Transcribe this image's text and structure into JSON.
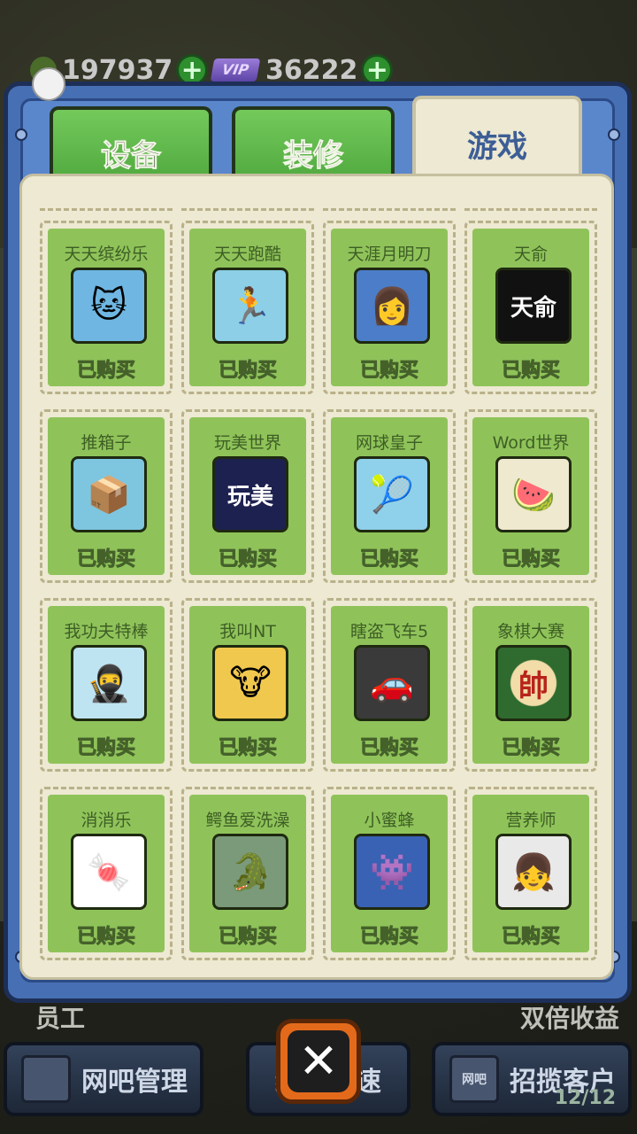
{
  "currencies": {
    "coins": "197937",
    "vip_label": "VIP",
    "vip_points": "36222"
  },
  "tabs": [
    {
      "label": "设备",
      "active": false
    },
    {
      "label": "装修",
      "active": false
    },
    {
      "label": "游戏",
      "active": true
    }
  ],
  "games": [
    {
      "name": "天天缤纷乐",
      "status": "已购买",
      "icon": "cat-icon",
      "bg": "#6fb7e2",
      "glyph": "🐱"
    },
    {
      "name": "天天跑酷",
      "status": "已购买",
      "icon": "runner-icon",
      "bg": "#8ccfe6",
      "glyph": "🏃"
    },
    {
      "name": "天涯月明刀",
      "status": "已购买",
      "icon": "swordswoman-icon",
      "bg": "#4c7dc8",
      "glyph": "👩"
    },
    {
      "name": "天俞",
      "status": "已购买",
      "icon": "tianyu-logo-icon",
      "bg": "#111111",
      "glyph": "天俞"
    },
    {
      "name": "推箱子",
      "status": "已购买",
      "icon": "box-push-icon",
      "bg": "#7ec6e0",
      "glyph": "📦"
    },
    {
      "name": "玩美世界",
      "status": "已购买",
      "icon": "wanmei-logo-icon",
      "bg": "#1d2150",
      "glyph": "玩美"
    },
    {
      "name": "网球皇子",
      "status": "已购买",
      "icon": "tennis-player-icon",
      "bg": "#8fd0ea",
      "glyph": "🎾"
    },
    {
      "name": "Word世界",
      "status": "已购买",
      "icon": "watermelon-icon",
      "bg": "#efe9cf",
      "glyph": "🍉"
    },
    {
      "name": "我功夫特棒",
      "status": "已购买",
      "icon": "kungfu-icon",
      "bg": "#bfe4f1",
      "glyph": "🥷"
    },
    {
      "name": "我叫NT",
      "status": "已购买",
      "icon": "bull-icon",
      "bg": "#f0c84d",
      "glyph": "🐮"
    },
    {
      "name": "瞎盗飞车5",
      "status": "已购买",
      "icon": "gun-car-icon",
      "bg": "#3a3a3a",
      "glyph": "🚗"
    },
    {
      "name": "象棋大赛",
      "status": "已购买",
      "icon": "chess-piece-icon",
      "bg": "#2f6b2f",
      "glyph": "帥"
    },
    {
      "name": "消消乐",
      "status": "已购买",
      "icon": "candy-tiles-icon",
      "bg": "#ffffff",
      "glyph": "🍬"
    },
    {
      "name": "鳄鱼爱洗澡",
      "status": "已购买",
      "icon": "crocodile-icon",
      "bg": "#7a9a7a",
      "glyph": "🐊"
    },
    {
      "name": "小蜜蜂",
      "status": "已购买",
      "icon": "space-invader-icon",
      "bg": "#3a62b4",
      "glyph": "👾"
    },
    {
      "name": "营养师",
      "status": "已购买",
      "icon": "chef-girl-icon",
      "bg": "#e9e9e9",
      "glyph": "👧"
    }
  ],
  "bottom": {
    "left_label": "员工",
    "right_label": "双倍收益",
    "manage_label": "网吧管理",
    "speed_label": "经营加速",
    "customer_label": "招揽客户",
    "customer_count": "12/12",
    "customer_sign": "网吧"
  }
}
